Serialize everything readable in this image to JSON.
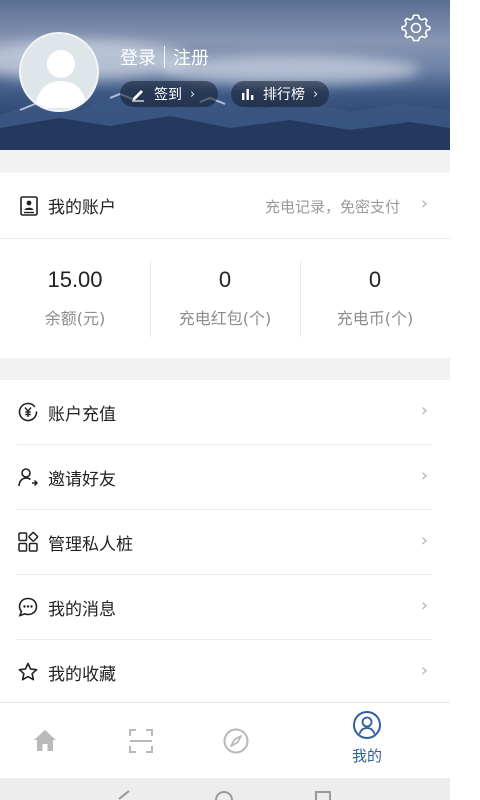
{
  "header": {
    "login_label": "登录",
    "register_label": "注册",
    "checkin_label": "签到",
    "ranking_label": "排行榜",
    "settings_icon": "gear-icon"
  },
  "account": {
    "title": "我的账户",
    "hint": "充电记录，免密支付",
    "stats": [
      {
        "value": "15.00",
        "label": "余额(元)"
      },
      {
        "value": "0",
        "label": "充电红包(个)"
      },
      {
        "value": "0",
        "label": "充电币(个)"
      }
    ]
  },
  "menu": [
    {
      "label": "账户充值",
      "icon": "yuan-circle-icon"
    },
    {
      "label": "邀请好友",
      "icon": "invite-user-icon"
    },
    {
      "label": "管理私人桩",
      "icon": "apps-grid-icon"
    },
    {
      "label": "我的消息",
      "icon": "message-bubble-icon"
    },
    {
      "label": "我的收藏",
      "icon": "star-icon"
    }
  ],
  "tabbar": {
    "mine_label": "我的"
  },
  "colors": {
    "accent": "#2f5f9e",
    "muted_text": "#8d8d8d",
    "page_bg": "#f2f2f2"
  }
}
